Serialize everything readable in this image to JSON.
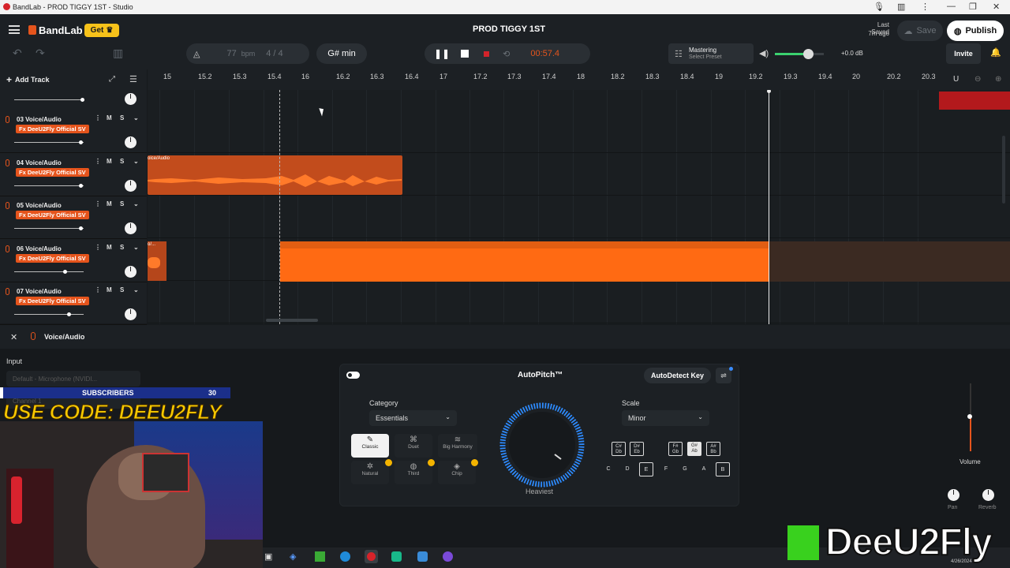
{
  "window": {
    "title": "BandLab - PROD TIGGY 1ST - Studio"
  },
  "header": {
    "brand": "BandLab",
    "get_label": "Get",
    "project_title": "PROD TIGGY 1ST",
    "bpm_value": "77",
    "bpm_unit": "bpm",
    "time_signature": "4 / 4",
    "key": "G# min",
    "time": "00:57.4",
    "mastering_title": "Mastering",
    "mastering_sub": "Select Preset",
    "volume_db": "+0.0 dB",
    "last_saved_line1": "Last Saved",
    "last_saved_line2": "7m ago",
    "save_label": "Save",
    "publish_label": "Publish",
    "invite_label": "Invite",
    "add_track_label": "Add Track"
  },
  "ruler": {
    "ticks": [
      "15",
      "15.2",
      "15.3",
      "15.4",
      "16",
      "16.2",
      "16.3",
      "16.4",
      "17",
      "17.2",
      "17.3",
      "17.4",
      "18",
      "18.2",
      "18.3",
      "18.4",
      "19",
      "19.2",
      "19.3",
      "19.4",
      "20",
      "20.2",
      "20.3"
    ]
  },
  "tracks": [
    {
      "number": "03",
      "name": "Voice/Audio",
      "fx": "Fx DeeU2Fly Official SV",
      "m": "M",
      "s": "S",
      "volume": 0.66
    },
    {
      "number": "04",
      "name": "Voice/Audio",
      "fx": "Fx DeeU2Fly Official SV",
      "m": "M",
      "s": "S",
      "volume": 0.66,
      "clip_label": "oice/Audio"
    },
    {
      "number": "05",
      "name": "Voice/Audio",
      "fx": "Fx DeeU2Fly Official SV",
      "m": "M",
      "s": "S",
      "volume": 0.66
    },
    {
      "number": "06",
      "name": "Voice/Audio",
      "fx": "Fx DeeU2Fly Official SV",
      "m": "M",
      "s": "S",
      "volume": 0.5,
      "clip_label": "o/..."
    },
    {
      "number": "07",
      "name": "Voice/Audio",
      "fx": "Fx DeeU2Fly Official SV",
      "m": "M",
      "s": "S",
      "volume": 0.54
    }
  ],
  "editor": {
    "track_label": "Voice/Audio",
    "input_label": "Input",
    "input_value": "Default - Microphone (NVIDI...",
    "channel_label": "Channel 1"
  },
  "autopitch": {
    "title": "AutoPitch™",
    "autodetect_label": "AutoDetect Key",
    "category_label": "Category",
    "category_value": "Essentials",
    "scale_label": "Scale",
    "scale_value": "Minor",
    "dial_label": "Heaviest",
    "options": [
      "Classic",
      "Duet",
      "Big Harmony",
      "Natural",
      "Third",
      "Chip"
    ],
    "sharp_keys": [
      [
        "C#",
        "Db"
      ],
      [
        "D#",
        "Eb"
      ],
      [
        "F#",
        "Gb"
      ],
      [
        "G#",
        "Ab"
      ],
      [
        "A#",
        "Bb"
      ]
    ],
    "natural_keys": [
      "C",
      "D",
      "E",
      "F",
      "G",
      "A",
      "B"
    ]
  },
  "right_controls": {
    "volume_label": "Volume",
    "pan_label": "Pan",
    "reverb_label": "Reverb"
  },
  "overlay": {
    "subscribers_label": "SUBSCRIBERS",
    "subscribers_count": "30",
    "use_code": "USE CODE: DEEU2FLY",
    "brand_text": "DeeU2Fly"
  },
  "taskbar": {
    "date": "4/26/2024"
  },
  "colors": {
    "accent": "#e5541c",
    "clip_bright": "#ff6a13",
    "clip_dim": "#7a3218"
  }
}
